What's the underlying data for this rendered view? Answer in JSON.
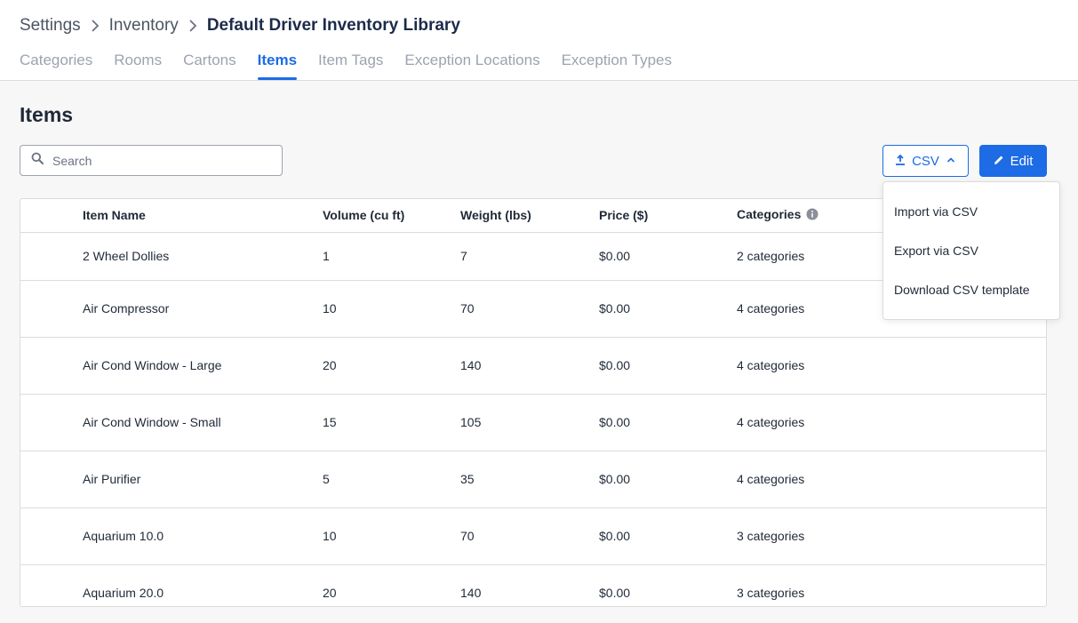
{
  "breadcrumb": {
    "items": [
      "Settings",
      "Inventory",
      "Default Driver Inventory Library"
    ]
  },
  "tabs": [
    {
      "label": "Categories",
      "active": false
    },
    {
      "label": "Rooms",
      "active": false
    },
    {
      "label": "Cartons",
      "active": false
    },
    {
      "label": "Items",
      "active": true
    },
    {
      "label": "Item Tags",
      "active": false
    },
    {
      "label": "Exception Locations",
      "active": false
    },
    {
      "label": "Exception Types",
      "active": false
    }
  ],
  "page": {
    "title": "Items"
  },
  "search": {
    "placeholder": "Search",
    "value": ""
  },
  "toolbar": {
    "csv_label": "CSV",
    "edit_label": "Edit"
  },
  "csv_menu": {
    "items": [
      "Import via CSV",
      "Export via CSV",
      "Download CSV template"
    ]
  },
  "table": {
    "columns": [
      "Item Name",
      "Volume (cu ft)",
      "Weight (lbs)",
      "Price ($)",
      "Categories"
    ],
    "rows": [
      [
        "2 Wheel Dollies",
        "1",
        "7",
        "$0.00",
        "2 categories"
      ],
      [
        "Air Compressor",
        "10",
        "70",
        "$0.00",
        "4 categories"
      ],
      [
        "Air Cond Window - Large",
        "20",
        "140",
        "$0.00",
        "4 categories"
      ],
      [
        "Air Cond Window - Small",
        "15",
        "105",
        "$0.00",
        "4 categories"
      ],
      [
        "Air Purifier",
        "5",
        "35",
        "$0.00",
        "4 categories"
      ],
      [
        "Aquarium 10.0",
        "10",
        "70",
        "$0.00",
        "3 categories"
      ],
      [
        "Aquarium 20.0",
        "20",
        "140",
        "$0.00",
        "3 categories"
      ]
    ]
  },
  "icons": {
    "breadcrumb_separator": "chevron-right-icon",
    "search": "search-icon",
    "csv": "upload-icon",
    "csv_toggle": "chevron-up-icon",
    "edit": "pencil-icon",
    "categories_info": "info-icon"
  },
  "colors": {
    "accent": "#1d6be5",
    "title": "#1c2b4a"
  }
}
